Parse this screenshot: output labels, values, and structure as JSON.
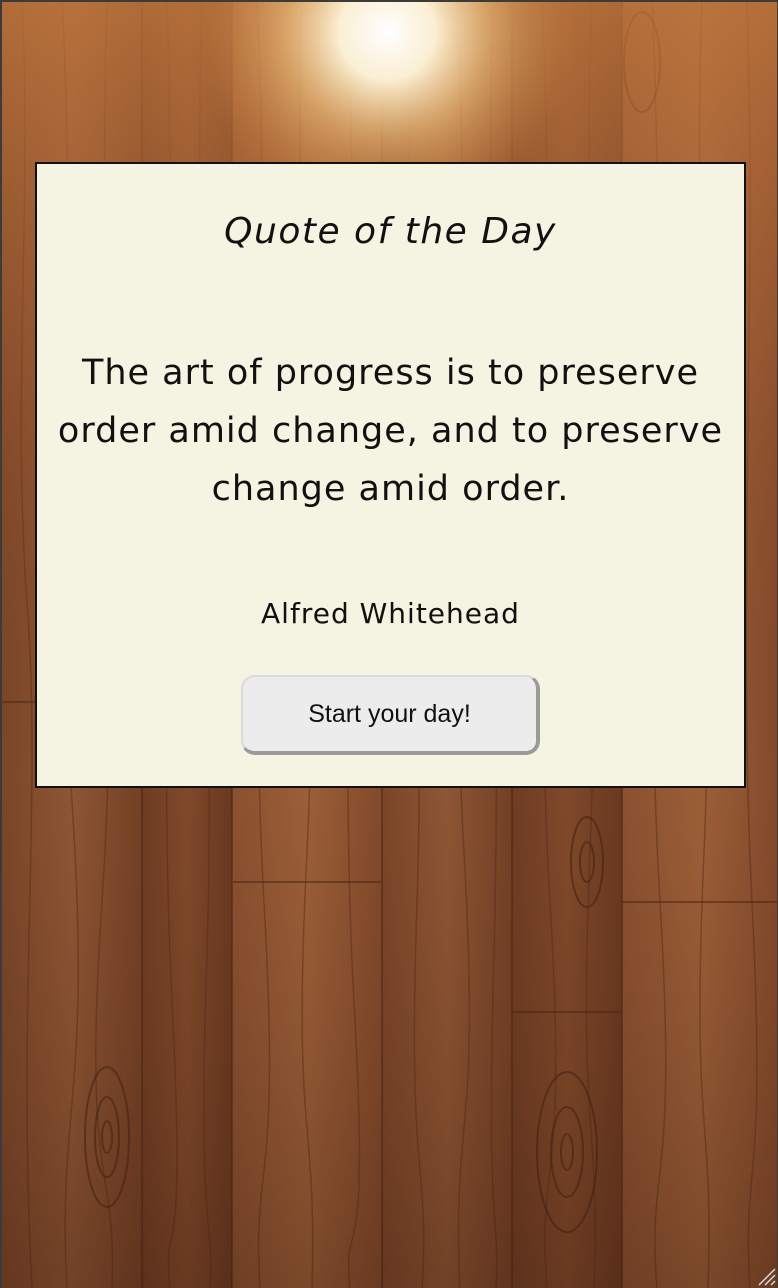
{
  "card": {
    "title": "Quote of the Day",
    "quote": "The art of progress is to preserve order amid change, and to preserve change amid order.",
    "author": "Alfred Whitehead",
    "button_label": "Start your day!"
  },
  "icons": {
    "background": "wood-planks-background",
    "grip": "resize-grip-icon"
  },
  "colors": {
    "card_background": "#f5f4e2",
    "card_border": "#111111",
    "text": "#111111",
    "button_background": "#ececec",
    "wood_base": "#7a4a2c",
    "wood_light": "#b06a3c",
    "spotlight": "#fff8e6"
  }
}
